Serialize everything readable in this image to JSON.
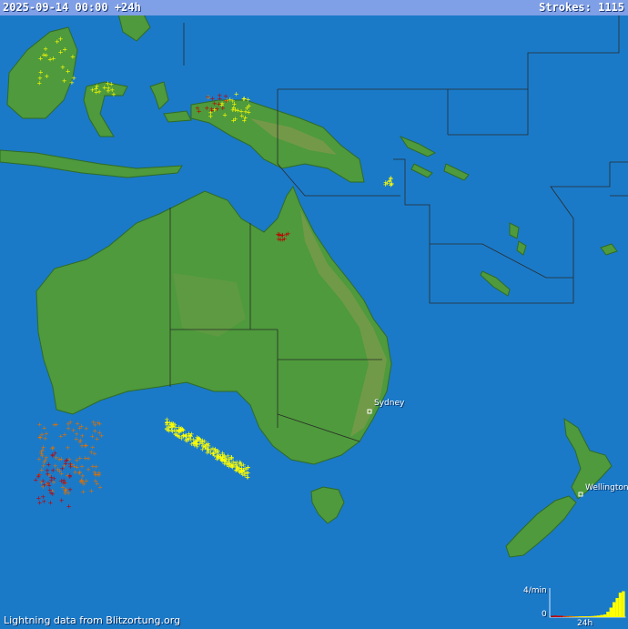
{
  "header": {
    "timestamp": "2025-09-14 00:00 +24h",
    "strokes_label": "Strokes: 1115"
  },
  "footer": {
    "credit": "Lightning data from Blitzortung.org"
  },
  "cities": [
    {
      "name": "Sydney"
    },
    {
      "name": "Wellington"
    }
  ],
  "histogram": {
    "y_max_label": "4/min",
    "y_min_label": "0",
    "x_label": "24h",
    "bars": [
      0.05,
      0.06,
      0.05,
      0.05,
      0.04,
      0.04,
      0.04,
      0.03,
      0.03,
      0.03,
      0.02,
      0.02,
      0.03,
      0.04,
      0.05,
      0.06,
      0.08,
      0.1,
      0.2,
      0.35,
      0.55,
      0.7,
      0.9,
      0.95
    ],
    "bar_colors": [
      "#b00000",
      "#c00000",
      "#c80000",
      "#d00000",
      "#d84000",
      "#e06000",
      "#e88000",
      "#f0a000",
      "#f0c000",
      "#f8d800",
      "#ffe800",
      "#fff000",
      "#fff200",
      "#fff400",
      "#fff600",
      "#fff800",
      "#ffff00",
      "#ffff00",
      "#ffff00",
      "#ffff00",
      "#ffff00",
      "#ffff00",
      "#ffff00",
      "#ffff00"
    ]
  },
  "colors": {
    "ocean": "#1a7ac8",
    "land": "#4e9a3c",
    "land_dark": "#3d8a30",
    "highland": "#8c9a50",
    "border": "#2a2a2a"
  }
}
